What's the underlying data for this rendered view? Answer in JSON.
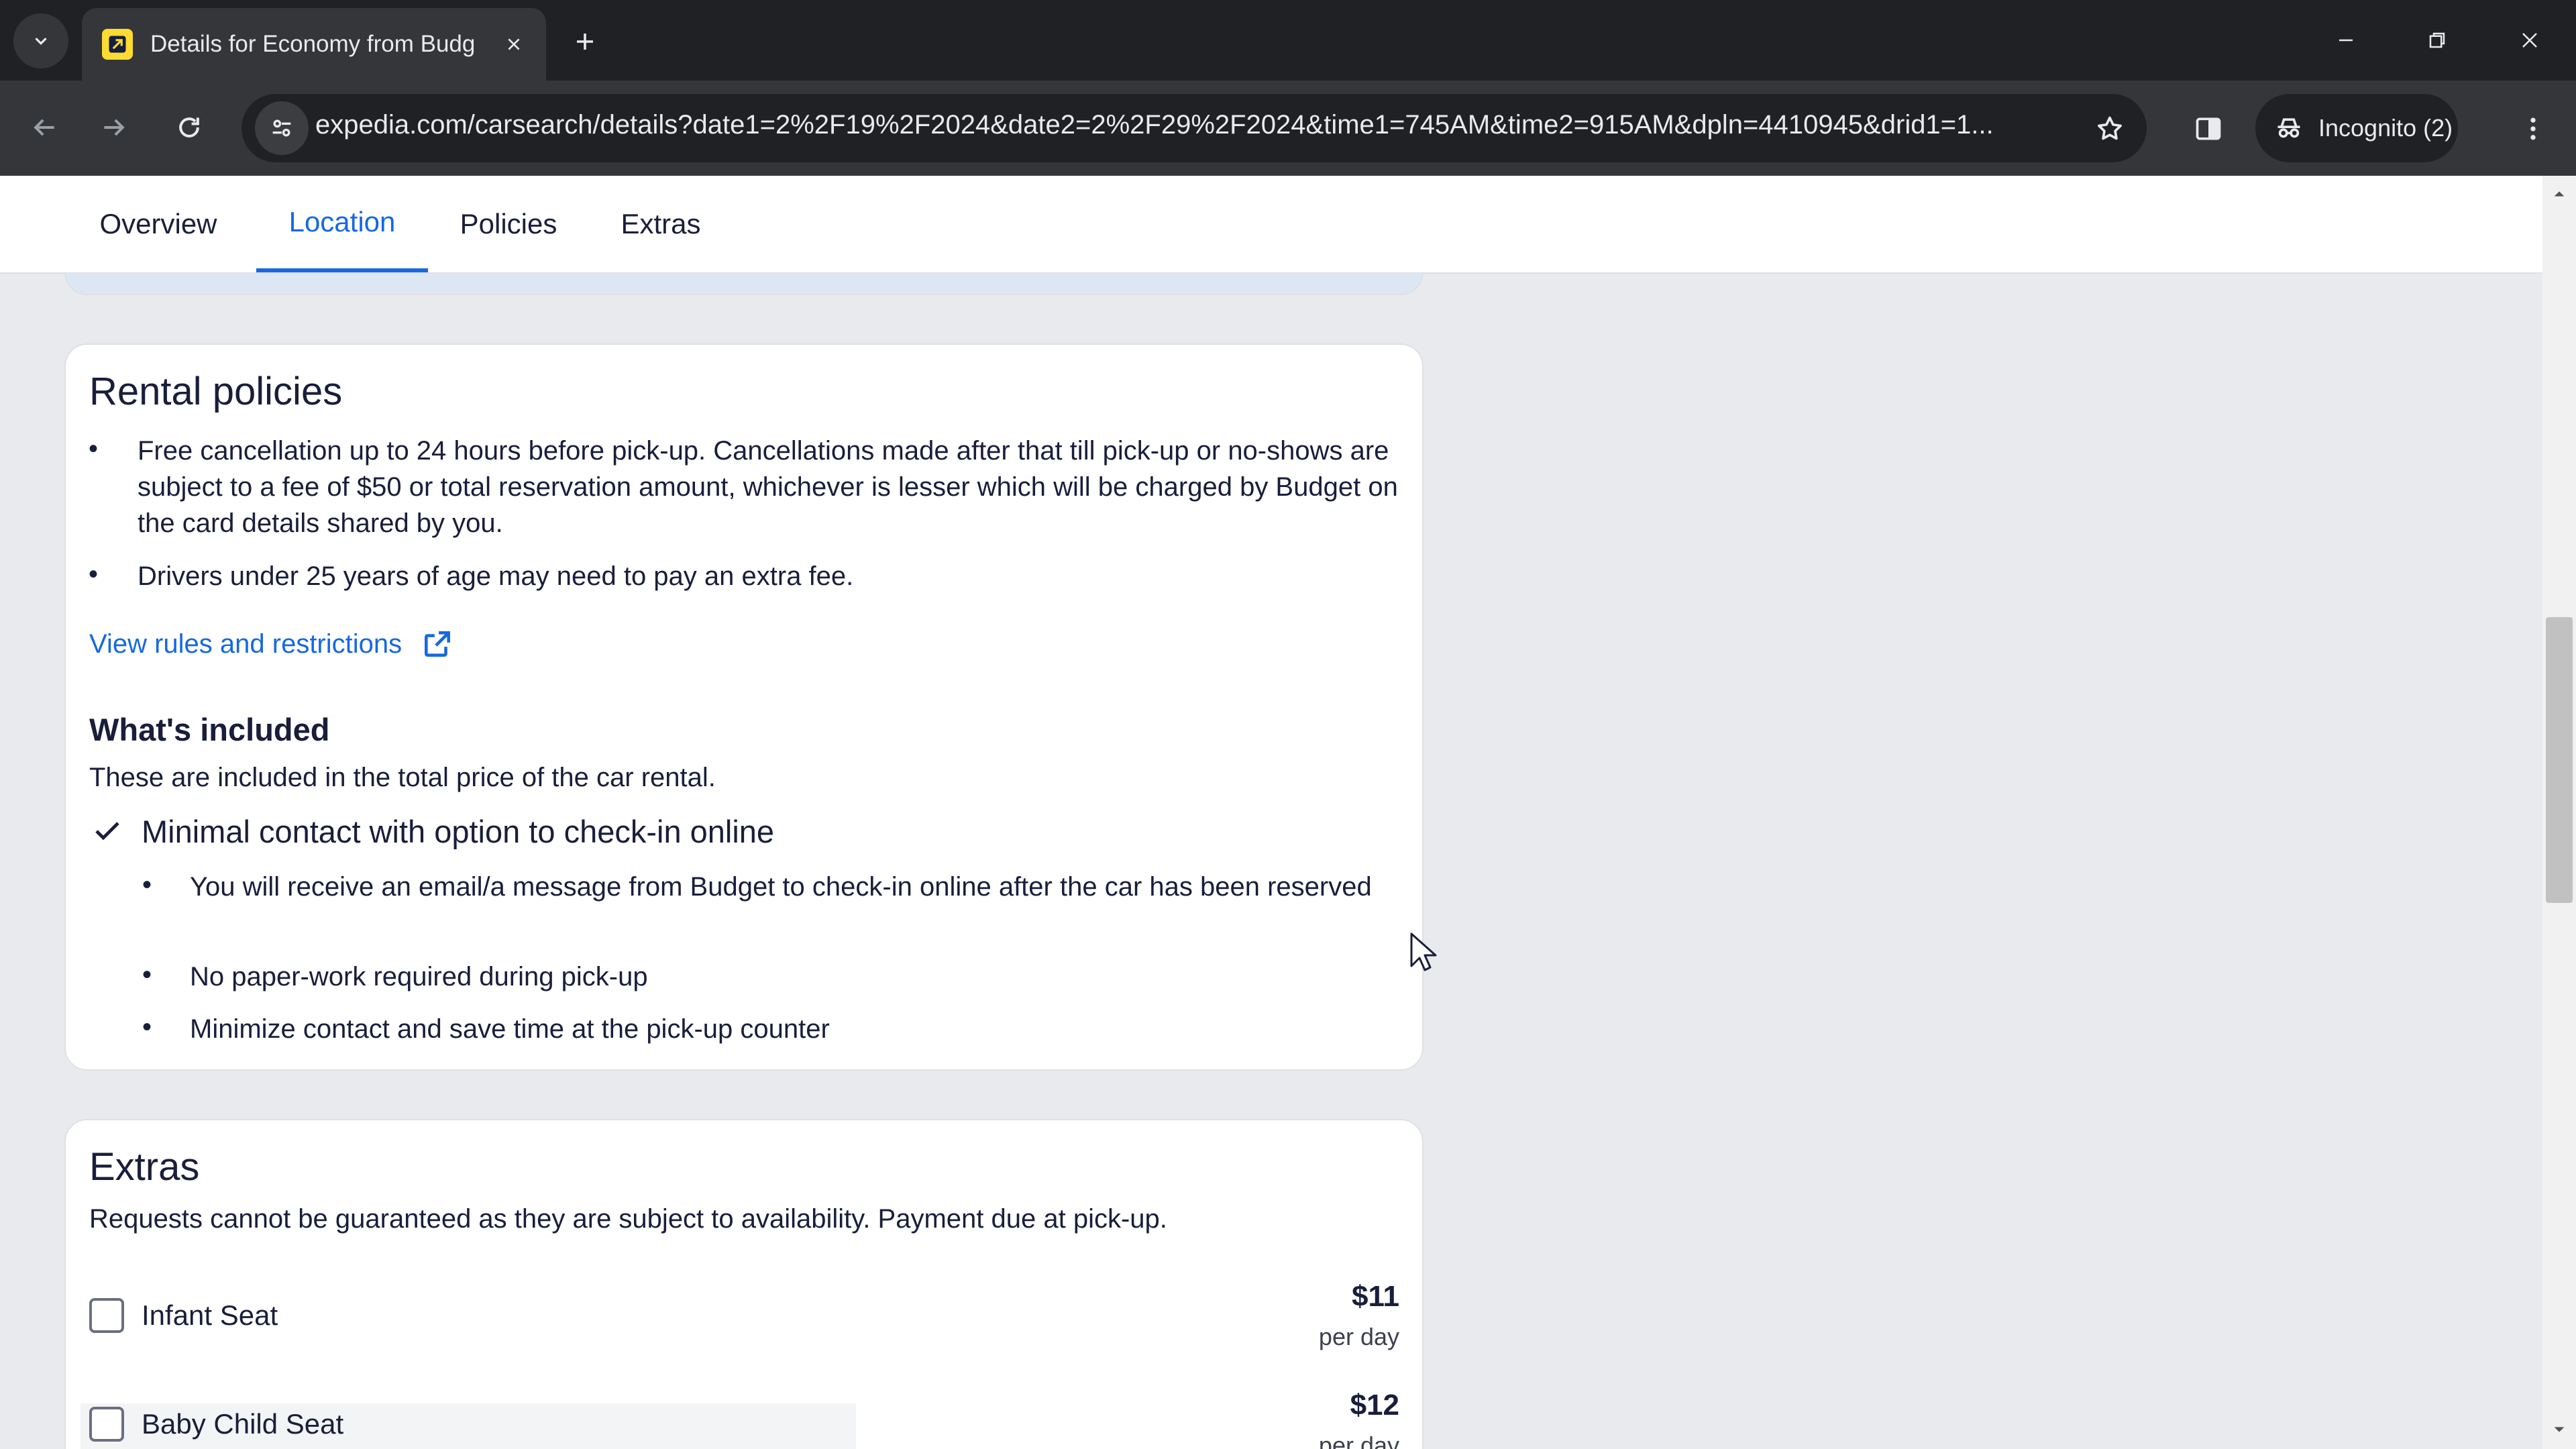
{
  "browser": {
    "tab_title": "Details for Economy from Budg",
    "url": "expedia.com/carsearch/details?date1=2%2F19%2F2024&date2=2%2F29%2F2024&time1=745AM&time2=915AM&dpln=4410945&drid1=1...",
    "incognito_label": "Incognito (2)"
  },
  "subnav": {
    "tabs": [
      "Overview",
      "Location",
      "Policies",
      "Extras"
    ],
    "active": "Location"
  },
  "rental_policies": {
    "title": "Rental policies",
    "bullets": [
      "Free cancellation up to 24 hours before pick-up. Cancellations made after that till pick-up or no-shows are subject to a fee of $50 or total reservation amount, whichever is lesser which will be charged by Budget on the card details shared by you.",
      "Drivers under 25 years of age may need to pay an extra fee."
    ],
    "rules_link": "View rules and restrictions",
    "whats_included": {
      "title": "What's included",
      "subtitle": "These are included in the total price of the car rental.",
      "feature": "Minimal contact with option to check-in online",
      "feature_bullets": [
        "You will receive an email/a message from Budget to check-in online after the car has been reserved",
        "No paper-work required during pick-up",
        "Minimize contact and save time at the pick-up counter"
      ]
    }
  },
  "extras": {
    "title": "Extras",
    "subtitle": "Requests cannot be guaranteed as they are subject to availability. Payment due at pick-up.",
    "items": [
      {
        "label": "Infant Seat",
        "price": "$11",
        "unit": "per day",
        "checked": false
      },
      {
        "label": "Baby Child Seat",
        "price": "$12",
        "unit": "per day",
        "checked": false
      }
    ]
  },
  "colors": {
    "link": "#1668e3",
    "text": "#191e3b",
    "background": "#e9eaee"
  }
}
